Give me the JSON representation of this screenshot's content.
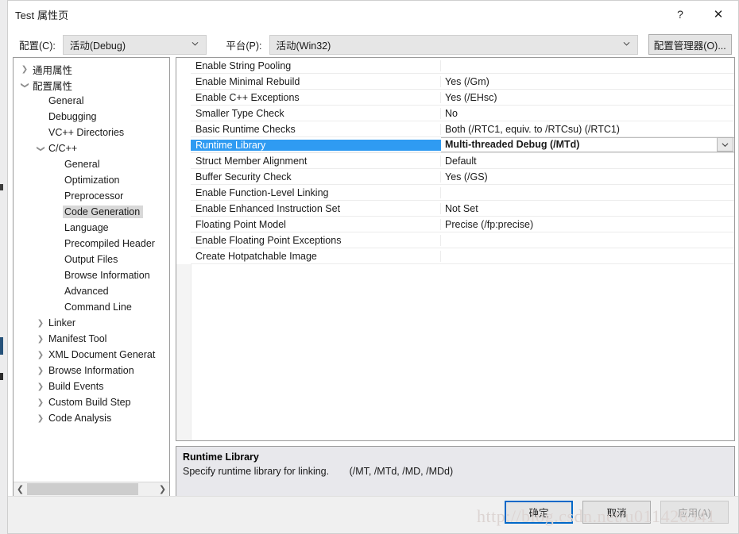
{
  "window": {
    "title": "Test 属性页",
    "help_button": "?",
    "close_button": "✕"
  },
  "config_bar": {
    "config_label": "配置(C):",
    "config_value": "活动(Debug)",
    "platform_label": "平台(P):",
    "platform_value": "活动(Win32)",
    "config_manager_button": "配置管理器(O)..."
  },
  "tree": {
    "items": [
      {
        "label": "通用属性",
        "indent": 0,
        "expander": "collapsed",
        "selected": false
      },
      {
        "label": "配置属性",
        "indent": 0,
        "expander": "expanded",
        "selected": false
      },
      {
        "label": "General",
        "indent": 1,
        "expander": "none",
        "selected": false
      },
      {
        "label": "Debugging",
        "indent": 1,
        "expander": "none",
        "selected": false
      },
      {
        "label": "VC++ Directories",
        "indent": 1,
        "expander": "none",
        "selected": false
      },
      {
        "label": "C/C++",
        "indent": 1,
        "expander": "expanded",
        "selected": false
      },
      {
        "label": "General",
        "indent": 2,
        "expander": "none",
        "selected": false
      },
      {
        "label": "Optimization",
        "indent": 2,
        "expander": "none",
        "selected": false
      },
      {
        "label": "Preprocessor",
        "indent": 2,
        "expander": "none",
        "selected": false
      },
      {
        "label": "Code Generation",
        "indent": 2,
        "expander": "none",
        "selected": true
      },
      {
        "label": "Language",
        "indent": 2,
        "expander": "none",
        "selected": false
      },
      {
        "label": "Precompiled Header",
        "indent": 2,
        "expander": "none",
        "selected": false
      },
      {
        "label": "Output Files",
        "indent": 2,
        "expander": "none",
        "selected": false
      },
      {
        "label": "Browse Information",
        "indent": 2,
        "expander": "none",
        "selected": false
      },
      {
        "label": "Advanced",
        "indent": 2,
        "expander": "none",
        "selected": false
      },
      {
        "label": "Command Line",
        "indent": 2,
        "expander": "none",
        "selected": false
      },
      {
        "label": "Linker",
        "indent": 1,
        "expander": "collapsed",
        "selected": false
      },
      {
        "label": "Manifest Tool",
        "indent": 1,
        "expander": "collapsed",
        "selected": false
      },
      {
        "label": "XML Document Generat",
        "indent": 1,
        "expander": "collapsed",
        "selected": false
      },
      {
        "label": "Browse Information",
        "indent": 1,
        "expander": "collapsed",
        "selected": false
      },
      {
        "label": "Build Events",
        "indent": 1,
        "expander": "collapsed",
        "selected": false
      },
      {
        "label": "Custom Build Step",
        "indent": 1,
        "expander": "collapsed",
        "selected": false
      },
      {
        "label": "Code Analysis",
        "indent": 1,
        "expander": "collapsed",
        "selected": false
      }
    ]
  },
  "grid": {
    "rows": [
      {
        "name": "Enable String Pooling",
        "value": "",
        "selected": false
      },
      {
        "name": "Enable Minimal Rebuild",
        "value": "Yes (/Gm)",
        "selected": false
      },
      {
        "name": "Enable C++ Exceptions",
        "value": "Yes (/EHsc)",
        "selected": false
      },
      {
        "name": "Smaller Type Check",
        "value": "No",
        "selected": false
      },
      {
        "name": "Basic Runtime Checks",
        "value": "Both (/RTC1, equiv. to /RTCsu) (/RTC1)",
        "selected": false
      },
      {
        "name": "Runtime Library",
        "value": "Multi-threaded Debug (/MTd)",
        "selected": true
      },
      {
        "name": "Struct Member Alignment",
        "value": "Default",
        "selected": false
      },
      {
        "name": "Buffer Security Check",
        "value": "Yes (/GS)",
        "selected": false
      },
      {
        "name": "Enable Function-Level Linking",
        "value": "",
        "selected": false
      },
      {
        "name": "Enable Enhanced Instruction Set",
        "value": "Not Set",
        "selected": false
      },
      {
        "name": "Floating Point Model",
        "value": "Precise (/fp:precise)",
        "selected": false
      },
      {
        "name": "Enable Floating Point Exceptions",
        "value": "",
        "selected": false
      },
      {
        "name": "Create Hotpatchable Image",
        "value": "",
        "selected": false
      }
    ]
  },
  "description": {
    "title": "Runtime Library",
    "text": "Specify runtime library for linking.",
    "switches": "(/MT, /MTd, /MD, /MDd)"
  },
  "footer": {
    "ok_label": "确定",
    "cancel_label": "取消",
    "apply_label": "应用(A)"
  },
  "watermark": {
    "text": "http://blog.csdn.net/u011426341"
  },
  "colors": {
    "selection_blue": "#2f9bf2",
    "default_button_border": "#0068c8",
    "tree_selection_gray": "#d8d8d8",
    "description_panel": "#e8e8ec"
  }
}
